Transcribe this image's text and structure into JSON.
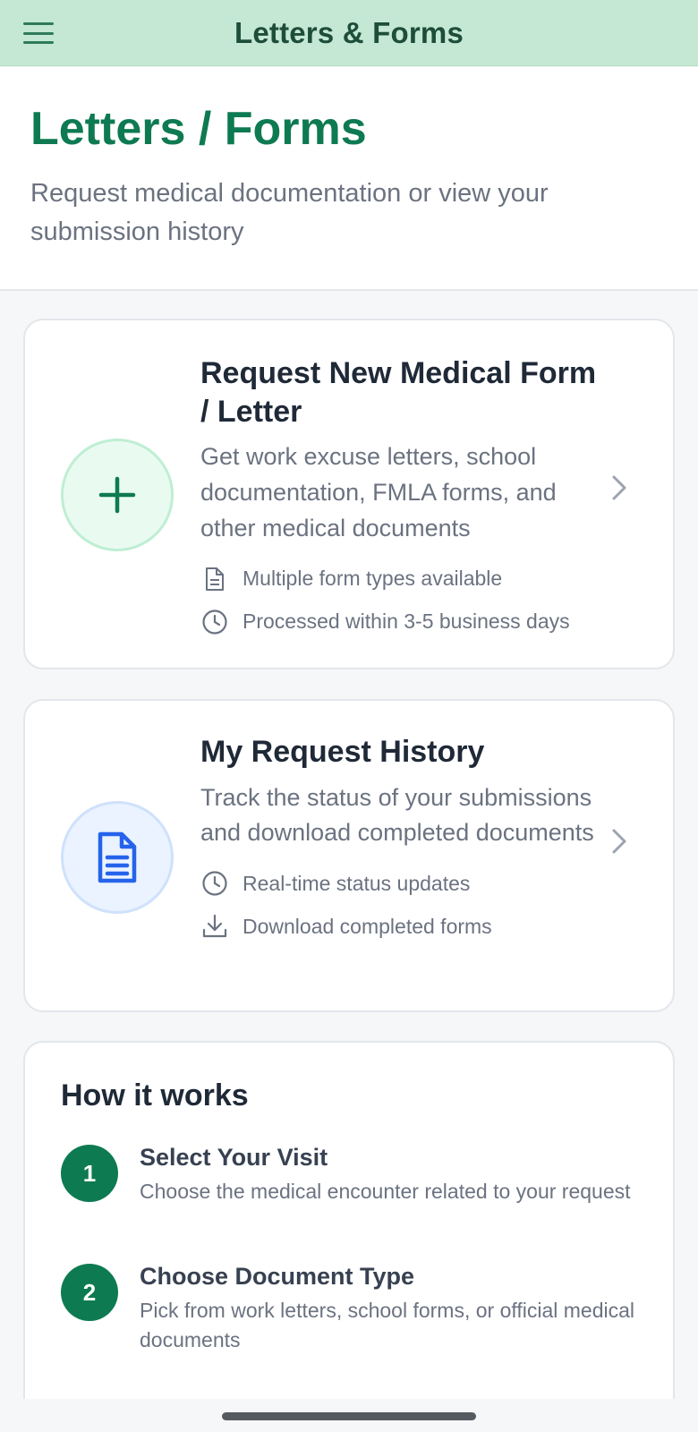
{
  "topbar": {
    "title": "Letters & Forms",
    "menu_icon": "hamburger-menu-icon"
  },
  "header": {
    "title": "Letters / Forms",
    "subtitle": "Request medical documentation or view your submission history"
  },
  "request_card": {
    "icon": "plus-icon",
    "title": "Request New Medical Form / Letter",
    "description": "Get work excuse letters, school documentation, FMLA forms, and other medical documents",
    "features": [
      {
        "icon": "document-icon",
        "text": "Multiple form types available"
      },
      {
        "icon": "clock-icon",
        "text": "Processed within 3-5 business days"
      }
    ],
    "accent": "#0e7a52"
  },
  "history_card": {
    "icon": "document-lines-icon",
    "title": "My Request History",
    "description": "Track the status of your submissions and download completed documents",
    "features": [
      {
        "icon": "clock-icon",
        "text": "Real-time status updates"
      },
      {
        "icon": "download-icon",
        "text": "Download completed forms"
      }
    ],
    "accent": "#2563eb"
  },
  "how_it_works": {
    "title": "How it works",
    "steps": [
      {
        "number": "1",
        "title": "Select Your Visit",
        "description": "Choose the medical encounter related to your request"
      },
      {
        "number": "2",
        "title": "Choose Document Type",
        "description": "Pick from work letters, school forms, or official medical documents"
      }
    ]
  },
  "colors": {
    "topbar_bg": "#c4e8d3",
    "brand_green": "#0e7a52",
    "muted_text": "#6b7280"
  }
}
